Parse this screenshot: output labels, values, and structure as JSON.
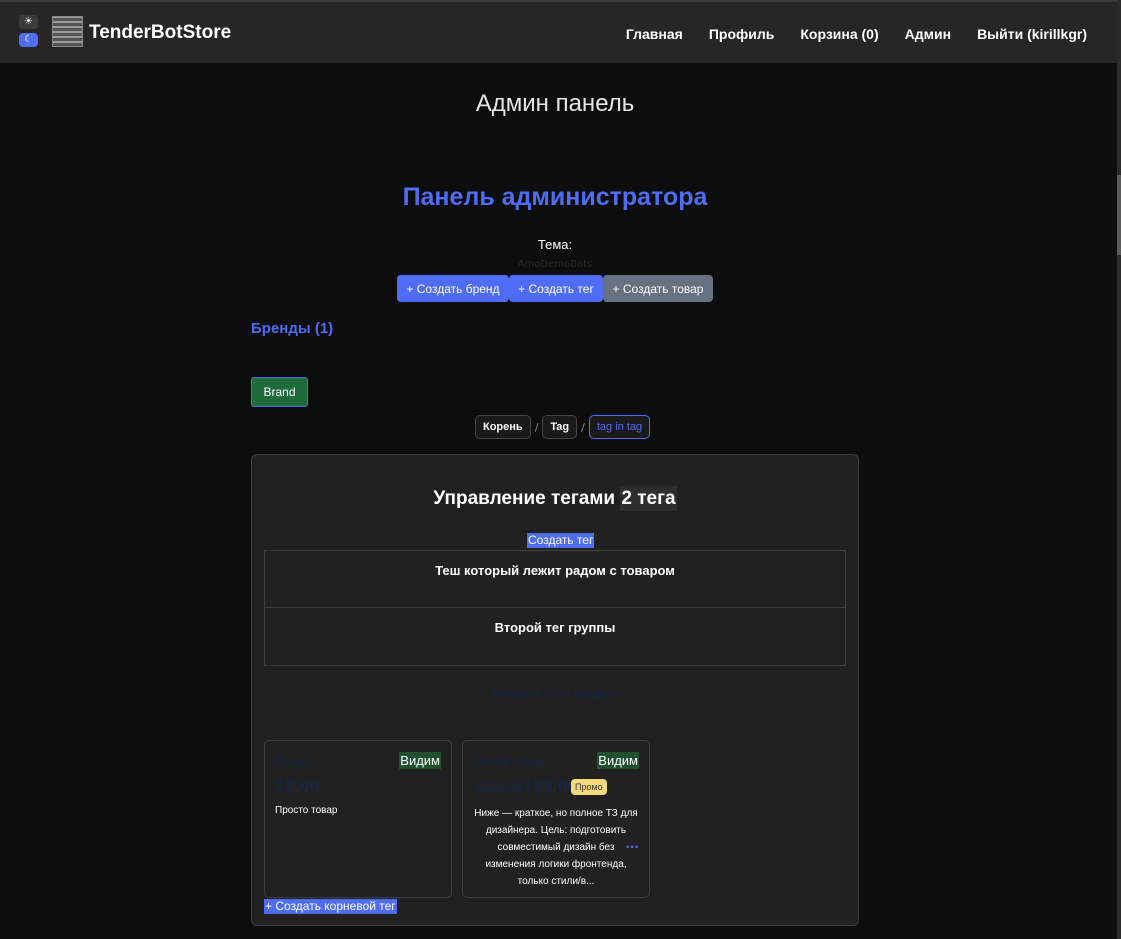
{
  "navbar": {
    "theme_light_icon": "☀",
    "theme_dark_icon": "☾",
    "brand": "TenderBotStore",
    "links": [
      "Главная",
      "Профиль",
      "Корзина (0)",
      "Админ",
      "Выйти (kirillkgr)"
    ]
  },
  "page": {
    "title": "Админ панель",
    "admin_heading": "Панель администратора",
    "theme_label": "Тема:",
    "theme_value": "AmoDemoBots"
  },
  "actions": {
    "create_brand": "+ Создать бренд",
    "create_tag": "+ Создать тег",
    "create_product": "+ Создать товар"
  },
  "brands": {
    "heading": "Бренды (1)",
    "items": [
      "Brand"
    ]
  },
  "breadcrumbs": {
    "items": [
      "Корень",
      "Tag",
      "tag in tag"
    ],
    "separator": "/"
  },
  "tags_panel": {
    "title": "Управление тегами",
    "count": "2 тега",
    "create_tag": "Создать тег",
    "tags": [
      "Теш который лежит радом с товаром",
      "Второй тег группы"
    ],
    "products_heading": "Товары в этом разделе",
    "create_root": "+ Создать корневой тег"
  },
  "products": [
    {
      "name": "Товар",
      "status": "Видим",
      "price": "12.00",
      "description": "Просто товар"
    },
    {
      "name": "Новый товар",
      "status": "Видим",
      "old_price": "3123.00",
      "price": "123.00",
      "promo": "Промо",
      "description": "Ниже — краткое, но полное ТЗ для дизайнера. Цель: подготовить совместимый дизайн без изменения логики фронтенда, только стили/в...",
      "more": "..."
    }
  ],
  "colors": {
    "accent": "#4f6cf5",
    "success": "#1f6b3c",
    "promo": "#f5d97a",
    "background": "#0d0d0d",
    "navbar": "#262626"
  }
}
